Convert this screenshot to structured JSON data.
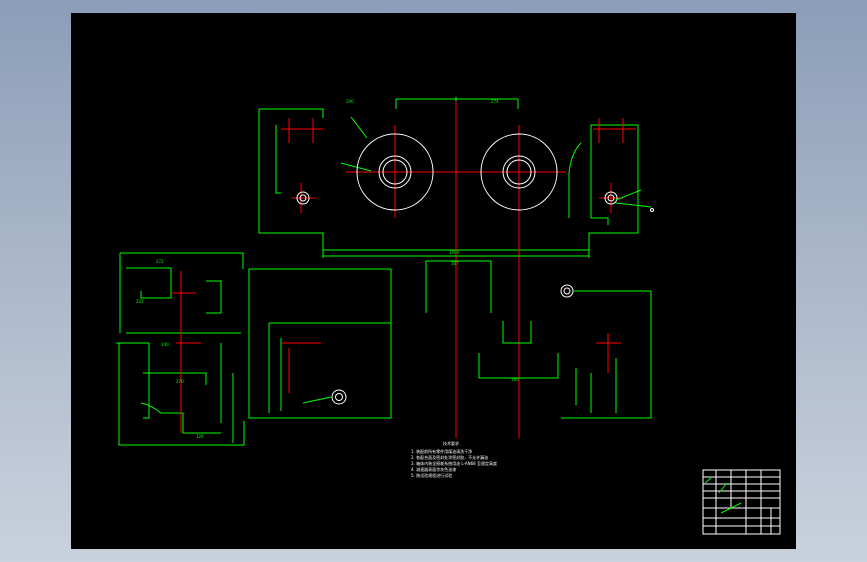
{
  "viewer": {
    "background": "#000000",
    "line_colors": {
      "outline": "#00ff00",
      "centerline": "#ff0000",
      "geometry": "#ffffff"
    }
  },
  "drawing": {
    "dimensions": {
      "top_left": "290",
      "top_right": "274",
      "overall_bottom": "1000",
      "center_top": "307",
      "left_view_top": "272",
      "left_view_top2": "232",
      "left_view_mid": "140",
      "left_view_lower": "270",
      "left_view_bottom": "126",
      "center_bottom": "160"
    },
    "notes_title": "技术要求",
    "notes": [
      "1. 装配前所有零件用煤油清洗干净",
      "2. 各配合面及密封处涂密封胶，不允许漏油",
      "3. 箱体内装全损耗系统用油 L-AN68 至规定高度",
      "4. 减速器表面涂灰色油漆",
      "5. 按试验规程进行试验"
    ]
  }
}
